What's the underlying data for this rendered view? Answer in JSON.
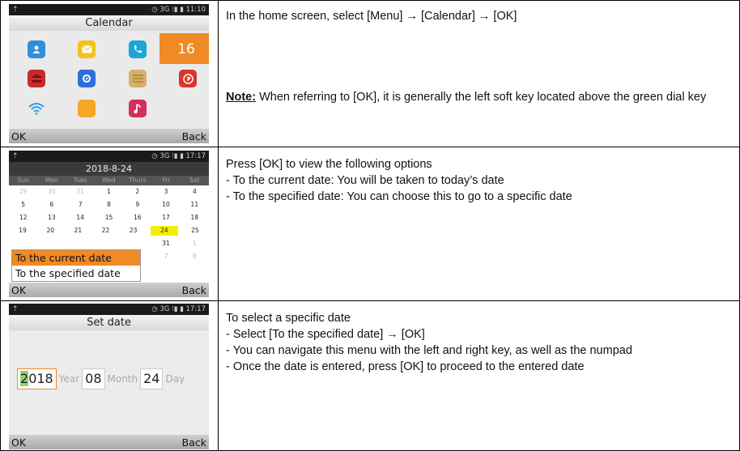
{
  "rows": [
    {
      "phone": {
        "status_left": "⇡",
        "status_right": "◷ 3G ⁝▮ ▮ 11:10",
        "title": "Calendar",
        "selected_app_label": "16",
        "softkey_left": "OK",
        "softkey_right": "Back"
      },
      "text": {
        "line1": "In the home screen, select [Menu] → [Calendar] → [OK]",
        "note_label": "Note:",
        "note_text": " When referring to [OK], it is generally the left soft key located above the green dial key"
      }
    },
    {
      "phone": {
        "status_left": "⇡",
        "status_right": "◷ 3G ⁝▮ ▮ 17:17",
        "header": "2018-8-24",
        "weekdays": [
          "Sun",
          "Mon",
          "Tues",
          "Wed",
          "Thurs",
          "Fri",
          "Sat"
        ],
        "weeks": [
          [
            "29",
            "30",
            "31",
            "1",
            "2",
            "3",
            "4"
          ],
          [
            "5",
            "6",
            "7",
            "8",
            "9",
            "10",
            "11"
          ],
          [
            "12",
            "13",
            "14",
            "15",
            "16",
            "17",
            "18"
          ],
          [
            "19",
            "20",
            "21",
            "22",
            "23",
            "24",
            "25"
          ],
          [
            "",
            "",
            "",
            "",
            "",
            "31",
            "1"
          ],
          [
            "",
            "",
            "",
            "",
            "",
            "7",
            "8"
          ]
        ],
        "menu_options": [
          "To the current date",
          "To the specified date"
        ],
        "softkey_left": "OK",
        "softkey_right": "Back"
      },
      "text": {
        "line1": "Press [OK] to view the following options",
        "line2": "- To the current date: You will be taken to today’s date",
        "line3": "- To the specified date: You can choose this to go to a specific date"
      }
    },
    {
      "phone": {
        "status_left": "⇡",
        "status_right": "◷ 3G ⁝▮ ▮ 17:17",
        "title": "Set date",
        "year_first_digit": "2",
        "year_rest": "018",
        "year_label": "Year",
        "month_value": "08",
        "month_label": "Month",
        "day_value": "24",
        "day_label": "Day",
        "softkey_left": "OK",
        "softkey_right": "Back"
      },
      "text": {
        "line1": "To select a specific date",
        "line2": "- Select [To the specified date] → [OK]",
        "line3": "- You can navigate this menu with the left and right key, as well as the numpad",
        "line4": "- Once the date is entered, press [OK] to proceed to the entered date"
      }
    }
  ],
  "colors": {
    "accent": "#f08a24",
    "today_highlight": "#f5f000",
    "cursor": "#8fd26b"
  },
  "app_icons": [
    "contacts-icon",
    "messages-icon",
    "phone-icon",
    "calendar-icon",
    "toolbox-icon",
    "settings-icon",
    "notes-icon",
    "browser-icon",
    "wifi-icon",
    "folder-icon",
    "music-icon"
  ]
}
